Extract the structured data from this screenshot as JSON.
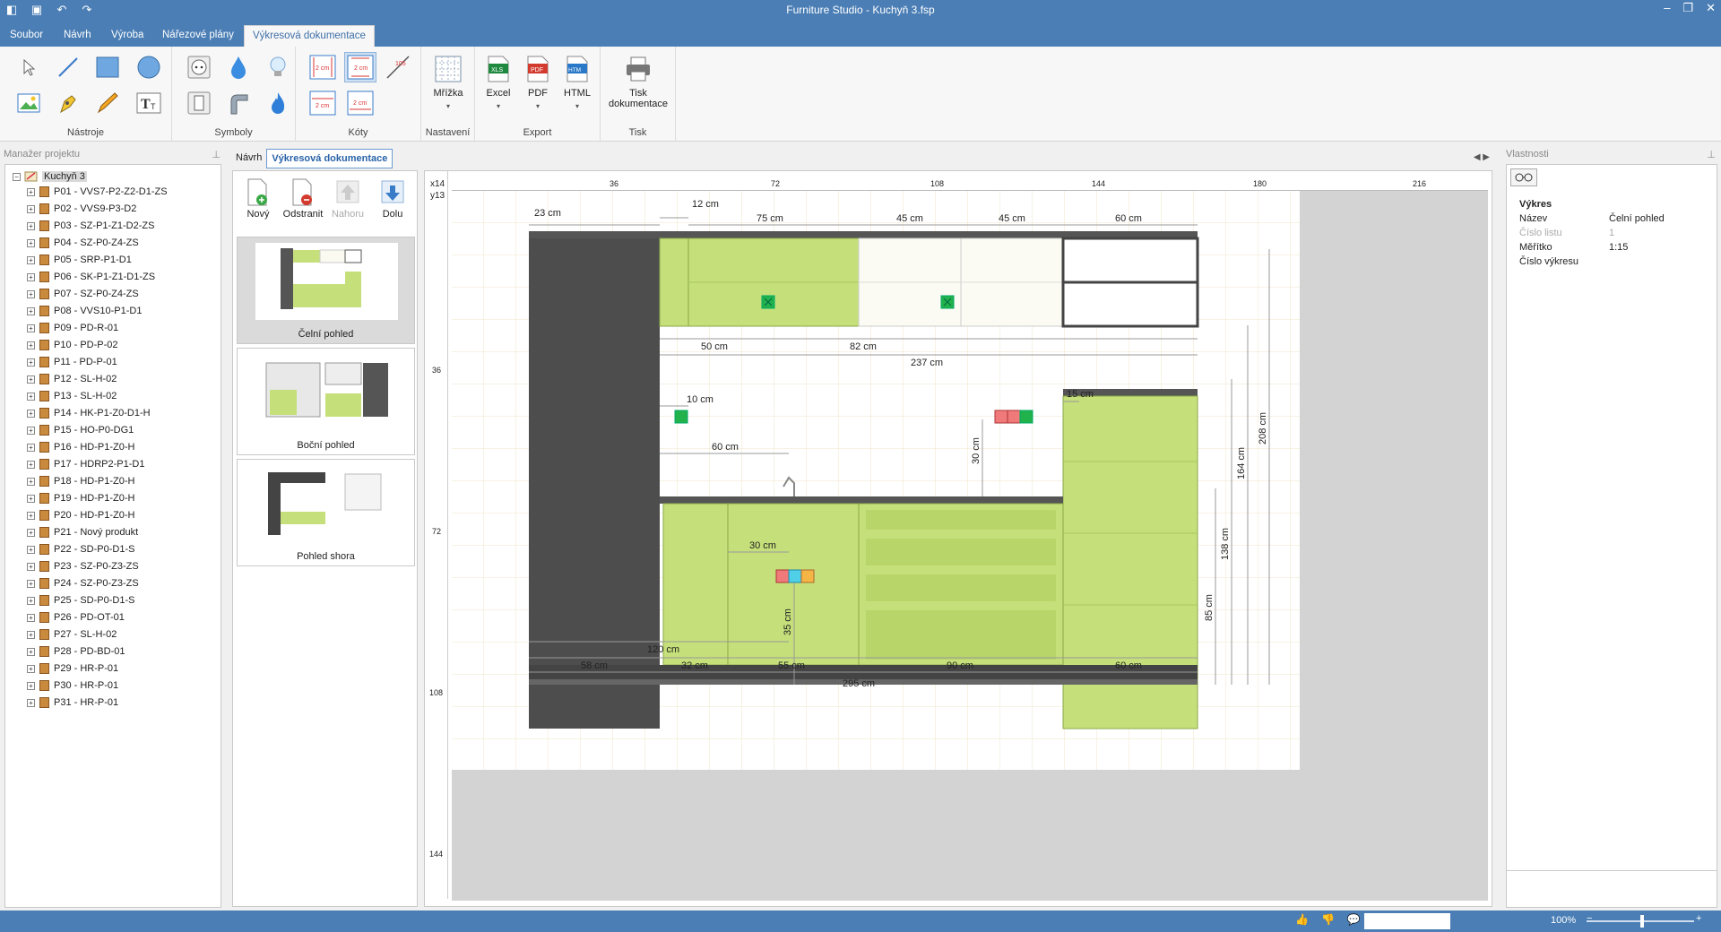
{
  "window": {
    "title": "Furniture Studio - Kuchyň 3.fsp"
  },
  "menu": {
    "tabs": [
      "Soubor",
      "Návrh",
      "Výroba",
      "Nářezové plány",
      "Výkresová dokumentace"
    ]
  },
  "ribbon": {
    "groups": {
      "tools": "Nástroje",
      "symbols": "Symboly",
      "dims": "Kóty",
      "settings": "Nastavení",
      "export": "Export",
      "print": "Tisk"
    },
    "grid_label": "Mřížka",
    "excel_label": "Excel",
    "pdf_label": "PDF",
    "html_label": "HTML",
    "print_label_1": "Tisk",
    "print_label_2": "dokumentace",
    "dim_icon_text": "2 cm",
    "angle_icon_text": "105"
  },
  "project": {
    "header": "Manažer projektu",
    "root": "Kuchyň 3",
    "items": [
      "P01 - VVS7-P2-Z2-D1-ZS",
      "P02 - VVS9-P3-D2",
      "P03 - SZ-P1-Z1-D2-ZS",
      "P04 - SZ-P0-Z4-ZS",
      "P05 - SRP-P1-D1",
      "P06 - SK-P1-Z1-D1-ZS",
      "P07 - SZ-P0-Z4-ZS",
      "P08 - VVS10-P1-D1",
      "P09 - PD-R-01",
      "P10 - PD-P-02",
      "P11 - PD-P-01",
      "P12 - SL-H-02",
      "P13 - SL-H-02",
      "P14 - HK-P1-Z0-D1-H",
      "P15 - HO-P0-DG1",
      "P16 - HD-P1-Z0-H",
      "P17 - HDRP2-P1-D1",
      "P18 - HD-P1-Z0-H",
      "P19 - HD-P1-Z0-H",
      "P20 - HD-P1-Z0-H",
      "P21 - Nový produkt",
      "P22 - SD-P0-D1-S",
      "P23 - SZ-P0-Z3-ZS",
      "P24 - SZ-P0-Z3-ZS",
      "P25 - SD-P0-D1-S",
      "P26 - PD-OT-01",
      "P27 - SL-H-02",
      "P28 - PD-BD-01",
      "P29 - HR-P-01",
      "P30 - HR-P-01",
      "P31 - HR-P-01"
    ]
  },
  "doc_tabs": [
    "Návrh",
    "Výkresová dokumentace"
  ],
  "sheets": {
    "buttons": [
      "Nový",
      "Odstranit",
      "Nahoru",
      "Dolu"
    ],
    "items": [
      "Čelní pohled",
      "Boční pohled",
      "Pohled shora"
    ]
  },
  "ruler": {
    "corner_x": "x14",
    "corner_y": "y13",
    "h_ticks": [
      "36",
      "72",
      "108",
      "144",
      "180",
      "216"
    ],
    "v_ticks": [
      "36",
      "72",
      "108",
      "144"
    ]
  },
  "drawing": {
    "dims": {
      "d23": "23 cm",
      "d12": "12 cm",
      "d75": "75 cm",
      "d45a": "45 cm",
      "d45b": "45 cm",
      "d60top": "60 cm",
      "d50": "50 cm",
      "d82": "82 cm",
      "d237": "237 cm",
      "d10": "10 cm",
      "d15": "15 cm",
      "d60mid": "60 cm",
      "d30v": "30 cm",
      "d208": "208 cm",
      "d164": "164 cm",
      "d138": "138 cm",
      "d85": "85 cm",
      "d30h": "30 cm",
      "d35": "35 cm",
      "d120": "120 cm",
      "d58": "58 cm",
      "d32": "32 cm",
      "d55": "55 cm",
      "d90": "90 cm",
      "d60bot": "60 cm",
      "d295": "295 cm"
    }
  },
  "properties": {
    "header": "Vlastnosti",
    "section": "Výkres",
    "rows": [
      {
        "k": "Název",
        "v": "Čelní pohled"
      },
      {
        "k": "Číslo listu",
        "v": "1"
      },
      {
        "k": "Měřítko",
        "v": "1:15"
      },
      {
        "k": "Číslo výkresu",
        "v": ""
      }
    ]
  },
  "status": {
    "zoom": "100%"
  },
  "colors": {
    "accent": "#4a7eb5",
    "cabinet_green": "#c5e07a",
    "cabinet_green_dark": "#9fc24a",
    "tall_unit": "#4d4d4d",
    "grid_line": "#eadfc0"
  }
}
